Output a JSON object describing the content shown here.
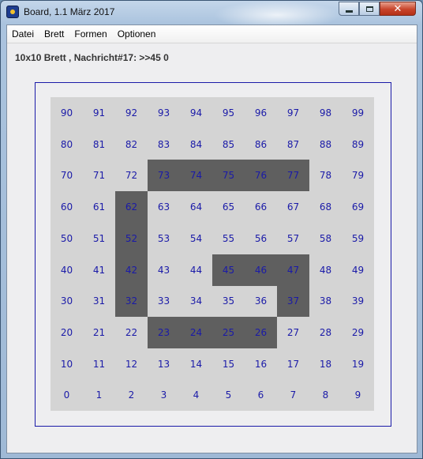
{
  "window": {
    "title": "Board, 1.1 März 2017",
    "controls": {
      "minimize": "",
      "maximize": "",
      "close": "✕"
    }
  },
  "menu": [
    "Datei",
    "Brett",
    "Formen",
    "Optionen"
  ],
  "message": "10x10 Brett , Nachricht#17: >>45 0",
  "colors": {
    "board": "#d4d4d4",
    "marked": "#5f5f5f",
    "number": "#1a1aa8",
    "frame": "#1a1aa8"
  },
  "board": {
    "rows": 10,
    "cols": 10,
    "numbers": [
      [
        90,
        91,
        92,
        93,
        94,
        95,
        96,
        97,
        98,
        99
      ],
      [
        80,
        81,
        82,
        83,
        84,
        85,
        86,
        87,
        88,
        89
      ],
      [
        70,
        71,
        72,
        73,
        74,
        75,
        76,
        77,
        78,
        79
      ],
      [
        60,
        61,
        62,
        63,
        64,
        65,
        66,
        67,
        68,
        69
      ],
      [
        50,
        51,
        52,
        53,
        54,
        55,
        56,
        57,
        58,
        59
      ],
      [
        40,
        41,
        42,
        43,
        44,
        45,
        46,
        47,
        48,
        49
      ],
      [
        30,
        31,
        32,
        33,
        34,
        35,
        36,
        37,
        38,
        39
      ],
      [
        20,
        21,
        22,
        23,
        24,
        25,
        26,
        27,
        28,
        29
      ],
      [
        10,
        11,
        12,
        13,
        14,
        15,
        16,
        17,
        18,
        19
      ],
      [
        0,
        1,
        2,
        3,
        4,
        5,
        6,
        7,
        8,
        9
      ]
    ],
    "marked": [
      73,
      74,
      75,
      76,
      77,
      62,
      52,
      42,
      32,
      45,
      46,
      47,
      37,
      23,
      24,
      25,
      26
    ]
  }
}
